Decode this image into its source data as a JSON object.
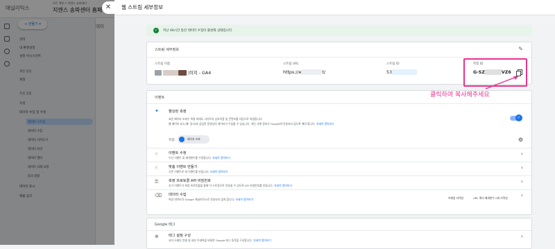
{
  "app": {
    "brand": "애널리틱스",
    "account_small": "모든 계정 > 지엔스 송파센터",
    "account_big": "지엔스 송파센터 홈페이지"
  },
  "left_nav": {
    "create_label": "만들기",
    "items": [
      "관리",
      "내 환경설정",
      "설정 어시스턴트"
    ],
    "sections": [
      "계정 설정",
      "계정",
      "속성 설정",
      "속성",
      "데이터 수집 및 수정"
    ],
    "sub_items": [
      "데이터 스트림",
      "데이터 수집",
      "데이터 가져오기",
      "데이터 보관",
      "데이터 필터",
      "데이터 삭제 요청",
      "동의 설정"
    ],
    "bottom_items": [
      "데이터 표시",
      "제품 링크"
    ]
  },
  "main_bg": {
    "title": "데이"
  },
  "panel": {
    "title": "웹 스트림 세부정보",
    "status": "지난 48시간 동안 데이터 수집이 활성화 상태입니다.",
    "details": {
      "heading": "스트림 세부정보",
      "name_label": "스트림 이름",
      "name_value": "|이지 - GA4",
      "url_label": "스트림 URL",
      "url_value_a": "https://e",
      "url_value_b": "t/",
      "id_label": "스트림 ID",
      "id_value": "53",
      "measure_label": "측정 ID",
      "measure_value_a": "G-SZ",
      "measure_value_b": "VZ6"
    },
    "events": {
      "heading": "이벤트",
      "enhanced_title": "향상된 측정",
      "enhanced_desc1": "표준 페이지 조회수 측정 외에도 사이트의 상호작용 및 콘텐츠를 자동으로 측정합니다.",
      "enhanced_desc2": "웹 페이지 요소(예: 링크)와 삽입된 동영상의 데이터가 수집될 수 있습니다. 개인 식별 정보가 Google에 전송되지 않도록 해야 합니다.",
      "learn_more": "자세히 알아보기",
      "measuring_label": "측정:",
      "measuring_chip": "페이지 조회",
      "rows": [
        {
          "title": "이벤트 수정",
          "desc": "수신 이벤트 및 매개변수를 수정합니다.",
          "link": "자세히 알아보기"
        },
        {
          "title": "맞춤 이벤트 만들기",
          "desc": "기존 이벤트로 새 이벤트를 만듭니다.",
          "link": "자세히 알아보기"
        },
        {
          "title": "측정 프로토콜 API 비밀번호",
          "desc": "추가 이벤트가 측정 프로토콜을 통해 이 스트림으로 전송될 수 있도록 API 비밀번호를 만듭니다.",
          "link": "자세히 알아보기"
        },
        {
          "title": "데이터 수집",
          "desc": "특정 데이터가 Google 애널리틱스로 전송되지 않게 합니다.",
          "link": "자세히 알아보기"
        }
      ],
      "redaction_chips": [
        "이메일 리댁션",
        "URL 쿼리 매개변수 0개 리댁션"
      ]
    },
    "gtag": {
      "heading": "Google 태그",
      "config_title": "태그 설정 구성",
      "config_desc": "교차 도메인 연결 및 내부 트래픽을 비롯한 Google 태그 동작을 구성합니다.",
      "config_link": "자세히 알아보기"
    }
  },
  "annotation": "클릭하여 복사해주세요",
  "colors": {
    "accent": "#1a73e8",
    "highlight": "#e8318c",
    "success": "#188038"
  }
}
